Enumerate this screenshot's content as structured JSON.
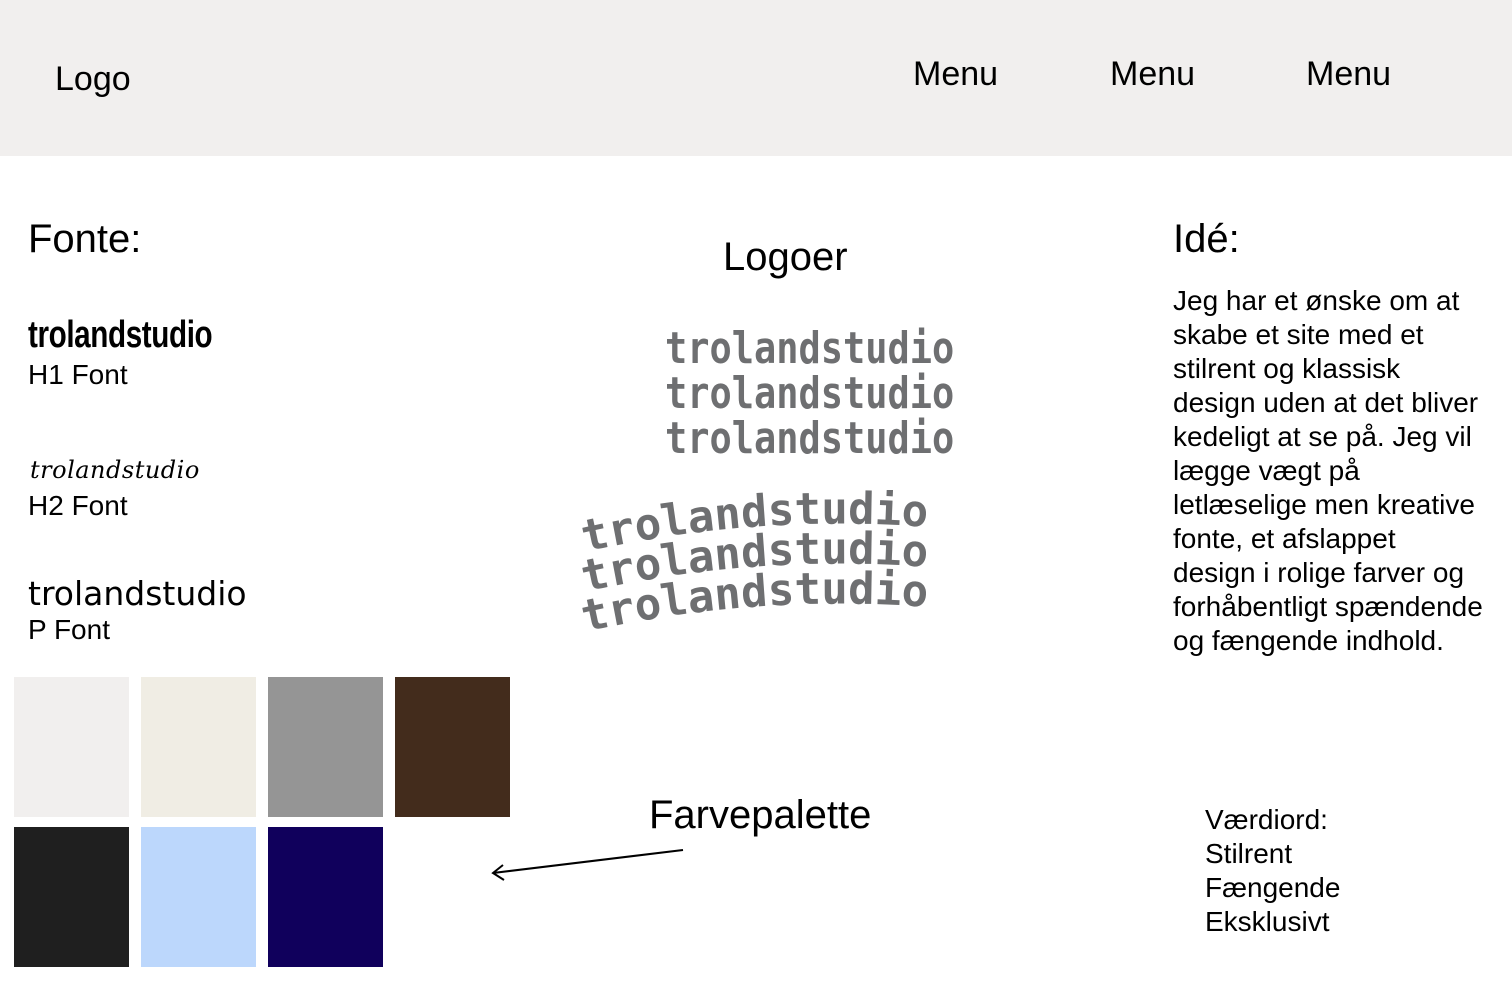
{
  "header": {
    "logo": "Logo",
    "menu": [
      "Menu",
      "Menu",
      "Menu"
    ],
    "background": "#f1efee"
  },
  "fonts": {
    "title": "Fonte:",
    "h1_sample": "trolandstudio",
    "h1_label": "H1 Font",
    "h2_sample": "trolandstudio",
    "h2_label": "H2 Font",
    "p_sample": "trolandstudio",
    "p_label": "P Font"
  },
  "logos": {
    "title": "Logoer",
    "stack": [
      "trolandstudio",
      "trolandstudio",
      "trolandstudio"
    ],
    "arched": [
      "trolandstudio",
      "trolandstudio",
      "trolandstudio"
    ],
    "color": "#6e6f71"
  },
  "palette": {
    "title": "Farvepalette",
    "colors": [
      "#f1efee",
      "#f0ede4",
      "#959595",
      "#432c1c",
      "#1f1f1f",
      "#bcd7fc",
      "#10005c"
    ]
  },
  "idea": {
    "title": "Idé:",
    "text": "Jeg har et ønske om at skabe et site med et stilrent og klassisk design uden at det bliver kedeligt at se på. Jeg vil lægge vægt på letlæselige men kreative fonte, et afslappet design i rolige farver og forhåbentligt spændende og fængende indhold."
  },
  "values": {
    "title": "Værdiord:",
    "items": [
      "Stilrent",
      "Fængende",
      "Eksklusivt"
    ]
  }
}
